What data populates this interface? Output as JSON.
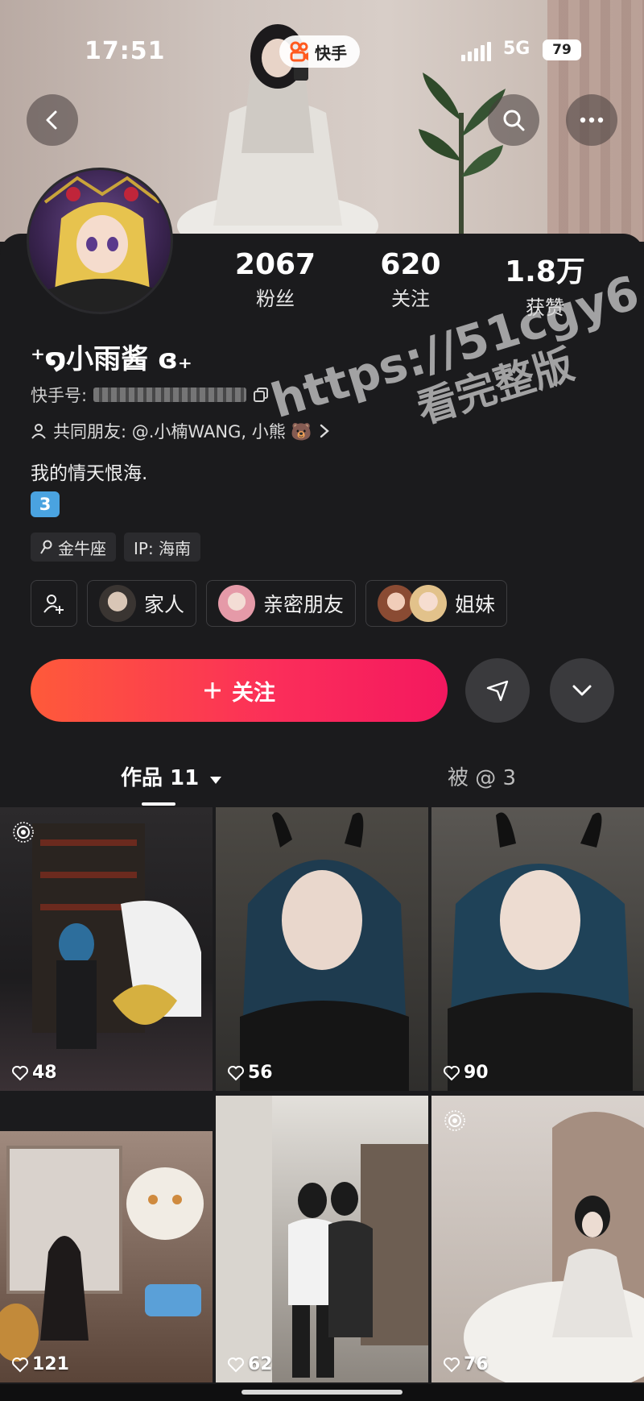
{
  "status_bar": {
    "time": "17:51",
    "network": "5G",
    "battery": "79",
    "app_badge": "快手"
  },
  "profile": {
    "name": "⁺໑小雨酱 ɞ₊",
    "kuaishou_id_label": "快手号:",
    "mutual_friends": "共同朋友: @.小楠WANG, 小熊 🐻",
    "bio": "我的情天恨海.",
    "number_badge": "3",
    "tags": [
      {
        "label": "金牛座"
      },
      {
        "label": "IP: 海南"
      }
    ]
  },
  "stats": [
    {
      "value": "2067",
      "label": "粉丝"
    },
    {
      "value": "620",
      "label": "关注"
    },
    {
      "value": "1.8万",
      "label": "获赞"
    }
  ],
  "groups": [
    {
      "label": "家人"
    },
    {
      "label": "亲密朋友"
    },
    {
      "label": "姐妹"
    }
  ],
  "actions": {
    "follow_label": "关注"
  },
  "tabs": [
    {
      "label": "作品 11"
    },
    {
      "label": "被 @ 3"
    }
  ],
  "posts": [
    {
      "likes": "48",
      "live": true
    },
    {
      "likes": "56",
      "live": false
    },
    {
      "likes": "90",
      "live": false
    },
    {
      "likes": "121",
      "live": false
    },
    {
      "likes": "62",
      "live": false
    },
    {
      "likes": "76",
      "live": true
    }
  ],
  "watermark": {
    "line1": "https://51cgy6.com",
    "line2": "看完整版"
  },
  "colors": {
    "follow_start": "#fe5a3a",
    "follow_end": "#f4185f",
    "background": "#1b1b1d"
  }
}
